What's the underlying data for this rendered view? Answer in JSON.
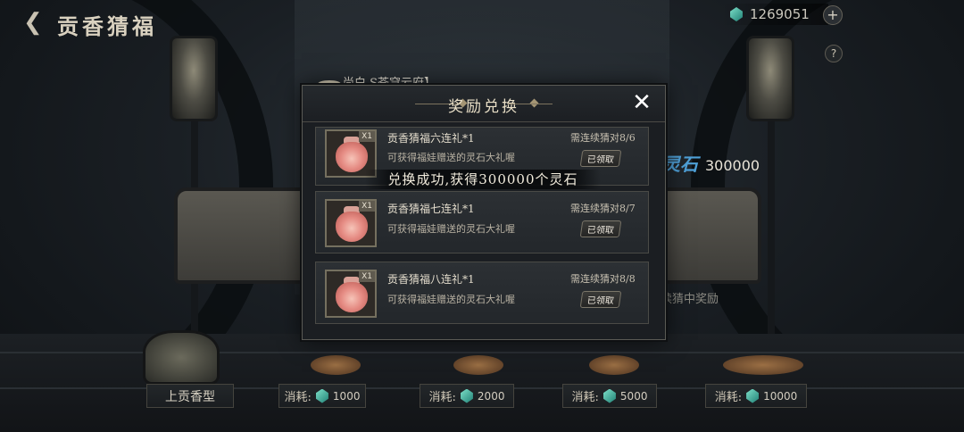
{
  "header": {
    "back_icon": "chevron-left-icon",
    "title": "贡香猜福"
  },
  "currency": {
    "icon": "spirit-gem-icon",
    "value": "1269051",
    "add_icon": "plus-icon",
    "help_icon": "question-icon"
  },
  "background": {
    "host_text": "尚白.S苍穹云府】",
    "spirit_stone_label": "灵石",
    "spirit_stone_value": "300000",
    "consecutive_reward_label": "续猜中奖励"
  },
  "modal": {
    "title": "奖励兑换",
    "close_icon": "close-icon",
    "rewards": [
      {
        "qty": "X1",
        "name": "贡香猜福六连礼*1",
        "desc": "可获得福娃赠送的灵石大礼喔",
        "requirement": "需连续猜对8/6",
        "status": "已领取"
      },
      {
        "qty": "X1",
        "name": "贡香猜福七连礼*1",
        "desc": "可获得福娃赠送的灵石大礼喔",
        "requirement": "需连续猜对8/7",
        "status": "已领取"
      },
      {
        "qty": "X1",
        "name": "贡香猜福八连礼*1",
        "desc": "可获得福娃赠送的灵石大礼喔",
        "requirement": "需连续猜对8/8",
        "status": "已领取"
      }
    ]
  },
  "toast": "兑换成功,获得300000个灵石",
  "bottom": {
    "incense_button": "上贡香型",
    "cost_label": "消耗:",
    "costs": [
      "1000",
      "2000",
      "5000",
      "10000"
    ]
  },
  "colors": {
    "accent_blue": "#4fa1d8",
    "panel_bg": "#1b1e22",
    "gem": "#3fb3a0"
  }
}
